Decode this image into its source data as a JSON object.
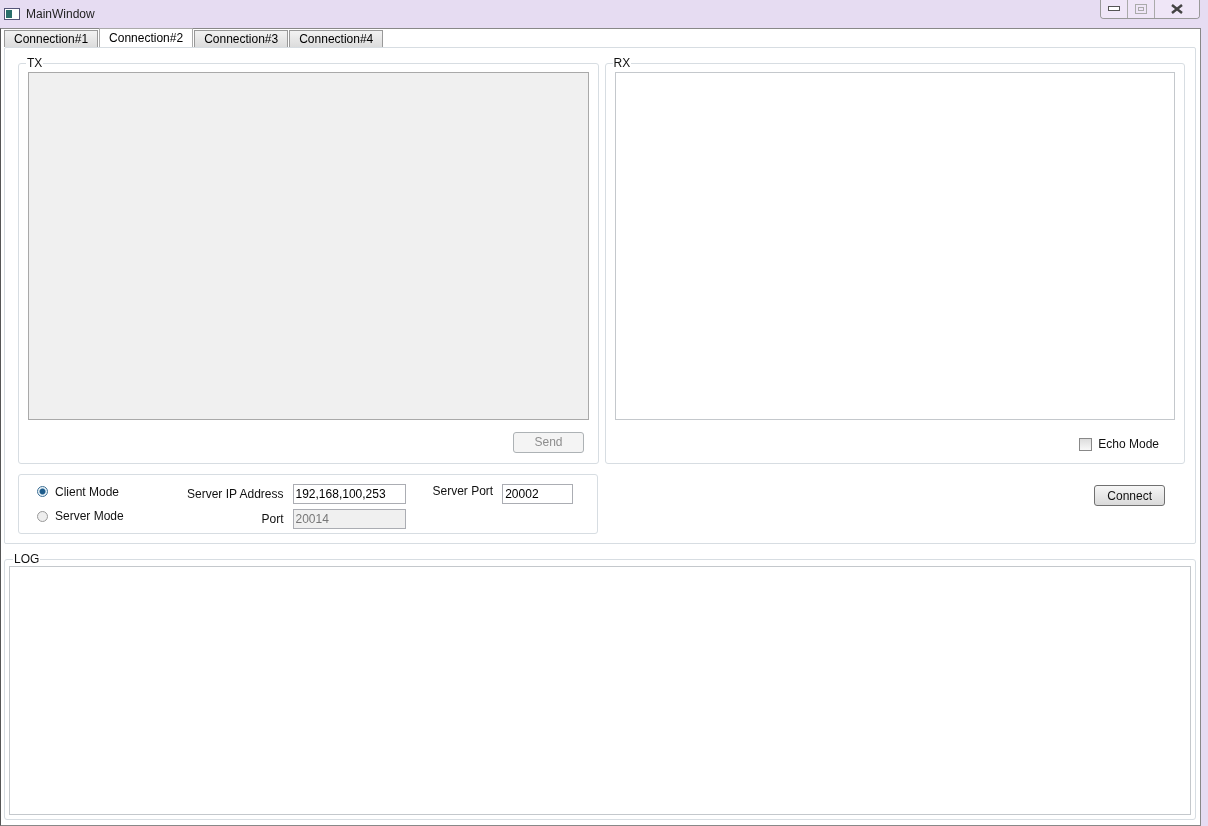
{
  "window": {
    "title": "MainWindow"
  },
  "tabs": [
    {
      "label": "Connection#1",
      "selected": false
    },
    {
      "label": "Connection#2",
      "selected": true
    },
    {
      "label": "Connection#3",
      "selected": false
    },
    {
      "label": "Connection#4",
      "selected": false
    }
  ],
  "tx": {
    "title": "TX",
    "disabled": true,
    "send_button": {
      "label": "Send",
      "disabled": true
    }
  },
  "rx": {
    "title": "RX",
    "echo_mode": {
      "label": "Echo Mode",
      "checked": false
    }
  },
  "modes": [
    {
      "label": "Client Mode",
      "selected": true
    },
    {
      "label": "Server Mode",
      "selected": false
    }
  ],
  "fields": [
    {
      "label": "Server IP Address",
      "value": "192,168,100,253",
      "disabled": false
    },
    {
      "label": "Port",
      "value": "20014",
      "disabled": true
    }
  ],
  "server_port": {
    "label": "Server Port",
    "value": "20002"
  },
  "connect_button": {
    "label": "Connect"
  },
  "log": {
    "title": "LOG"
  }
}
